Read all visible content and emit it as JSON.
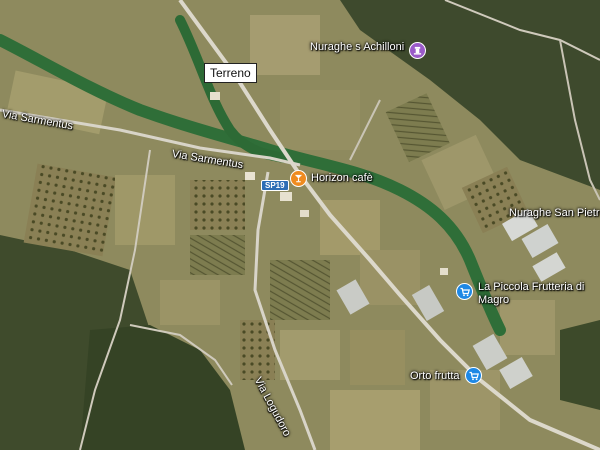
{
  "callout": {
    "label": "Terreno"
  },
  "road_shield": {
    "label": "SP19"
  },
  "roads": [
    {
      "name": "Via Sarmentus"
    },
    {
      "name": "Via Sarmentus"
    },
    {
      "name": "Via Logudoro"
    }
  ],
  "places": [
    {
      "name": "Nuraghe s Achilloni",
      "icon": "monument-icon",
      "color": "#9a5ac8"
    },
    {
      "name": "Horizon cafè",
      "icon": "cafe-icon",
      "color": "#ef8b1f"
    },
    {
      "name": "Nuraghe San Pietro",
      "icon": "none",
      "color": ""
    },
    {
      "name": "La Piccola Frutteria di Magro",
      "icon": "shopping-cart-icon",
      "color": "#1e88e5"
    },
    {
      "name": "Orto frutta",
      "icon": "shopping-cart-icon",
      "color": "#1e88e5"
    }
  ],
  "colors": {
    "farmland": "#8f8a5c",
    "forest": "#3d4a2a",
    "road": "#d6d3c8",
    "river_vegetation": "#2f6e38"
  }
}
